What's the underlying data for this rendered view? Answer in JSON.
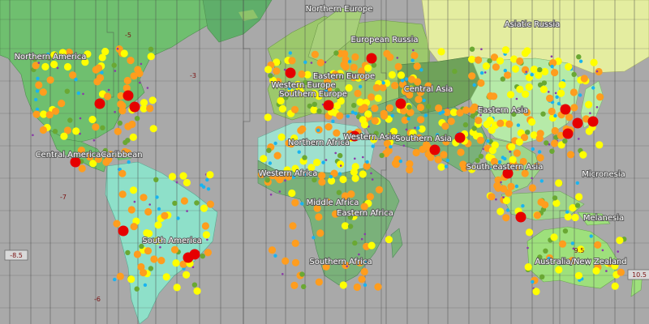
{
  "regions": [
    {
      "name": "Northern Europe"
    },
    {
      "name": "Asiatic Russia"
    },
    {
      "name": "Northern America"
    },
    {
      "name": "European Russia"
    },
    {
      "name": "Eastern Europe"
    },
    {
      "name": "Western Europe"
    },
    {
      "name": "Southern Europe"
    },
    {
      "name": "Central Asia"
    },
    {
      "name": "Eastern Asia"
    },
    {
      "name": "Northern Africa"
    },
    {
      "name": "Western Asia"
    },
    {
      "name": "Southern Asia"
    },
    {
      "name": "Central America"
    },
    {
      "name": "Caribbean"
    },
    {
      "name": "Western Africa"
    },
    {
      "name": "South-eastern Asia"
    },
    {
      "name": "Micronesia"
    },
    {
      "name": "Middle Africa"
    },
    {
      "name": "Eastern Africa"
    },
    {
      "name": "Melanesia"
    },
    {
      "name": "South America"
    },
    {
      "name": "Southern Africa"
    },
    {
      "name": "Australia/New Zealand"
    }
  ],
  "timezone_labels": [
    {
      "text": "-5"
    },
    {
      "text": "-3"
    },
    {
      "text": "-7"
    },
    {
      "text": "-8.5"
    },
    {
      "text": "-6"
    },
    {
      "text": "9.5"
    },
    {
      "text": "10.5"
    }
  ],
  "colors": {
    "ocean": "#a9a9a9",
    "north_america": "#6fbf6f",
    "south_america": "#8ee0c9",
    "europe": "#9cc86c",
    "africa_north": "#9fe0cf",
    "africa": "#7ab17a",
    "asia_north": "#e4eda0",
    "asia_east": "#b6eaa8",
    "central_asia": "#6fa25a",
    "australia": "#9ee07c",
    "gridline": "#4a4a4a",
    "city_red": "#e60000",
    "city_orange": "#ff9d1e",
    "city_yellow": "#ffff00",
    "city_green": "#6aa833",
    "city_cyan": "#19b4f0",
    "city_purple": "#8a3aa8"
  }
}
